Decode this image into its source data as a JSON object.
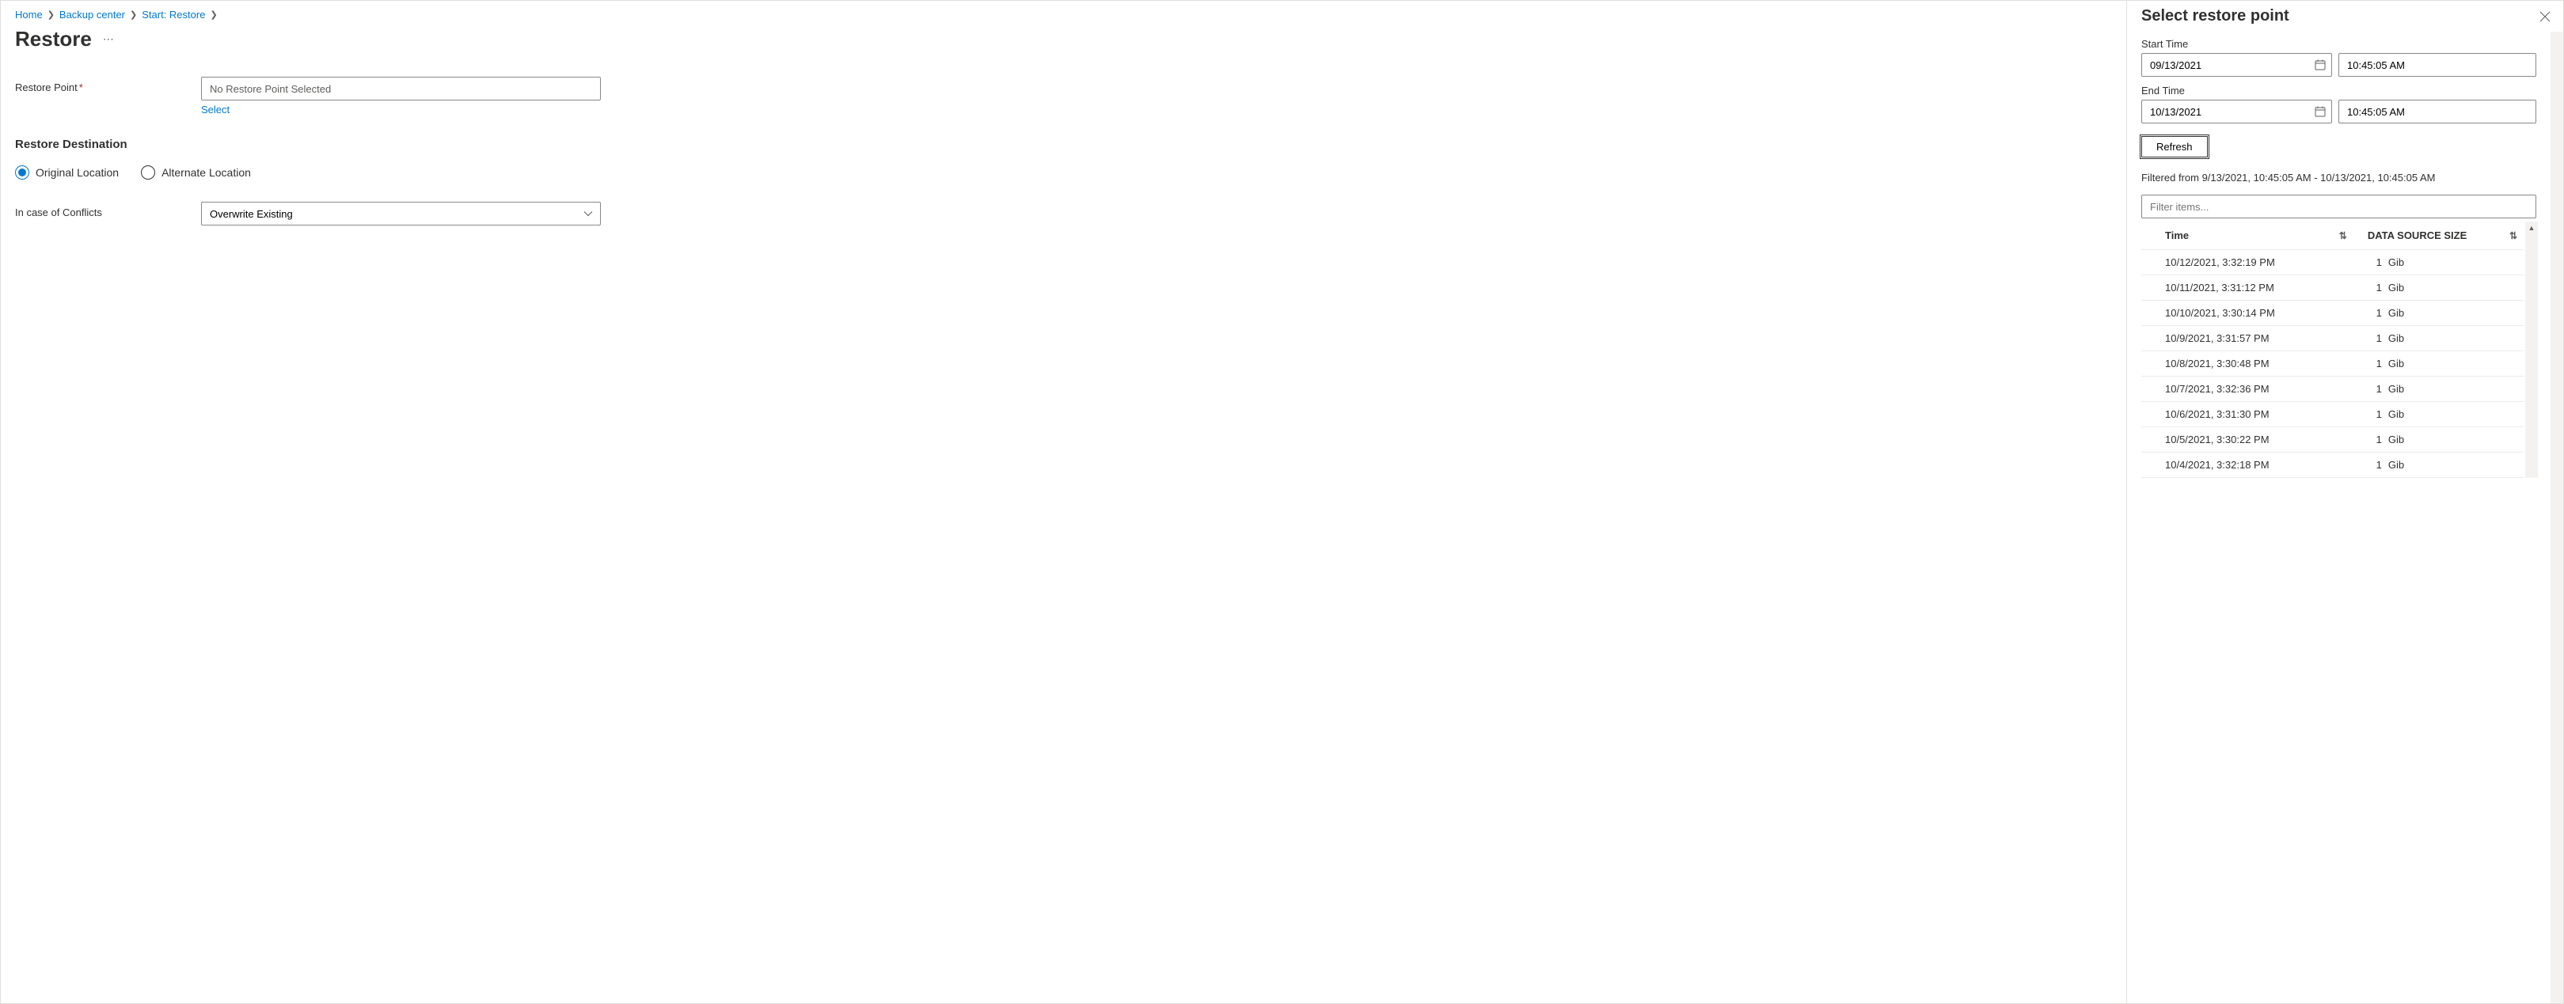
{
  "breadcrumb": [
    {
      "label": "Home"
    },
    {
      "label": "Backup center"
    },
    {
      "label": "Start: Restore"
    }
  ],
  "page": {
    "title": "Restore"
  },
  "form": {
    "restore_point_label": "Restore Point",
    "restore_point_placeholder": "No Restore Point Selected",
    "select_link": "Select",
    "destination_heading": "Restore Destination",
    "radio_original": "Original Location",
    "radio_alternate": "Alternate Location",
    "conflicts_label": "In case of Conflicts",
    "conflicts_value": "Overwrite Existing"
  },
  "panel": {
    "title": "Select restore point",
    "start_time_label": "Start Time",
    "end_time_label": "End Time",
    "start_date": "09/13/2021",
    "start_time": "10:45:05 AM",
    "end_date": "10/13/2021",
    "end_time": "10:45:05 AM",
    "refresh_label": "Refresh",
    "filtered_text": "Filtered from 9/13/2021, 10:45:05 AM - 10/13/2021, 10:45:05 AM",
    "filter_placeholder": "Filter items...",
    "columns": {
      "time": "Time",
      "size": "DATA SOURCE SIZE"
    },
    "rows": [
      {
        "time": "10/12/2021, 3:32:19 PM",
        "size_num": "1",
        "size_unit": "Gib"
      },
      {
        "time": "10/11/2021, 3:31:12 PM",
        "size_num": "1",
        "size_unit": "Gib"
      },
      {
        "time": "10/10/2021, 3:30:14 PM",
        "size_num": "1",
        "size_unit": "Gib"
      },
      {
        "time": "10/9/2021, 3:31:57 PM",
        "size_num": "1",
        "size_unit": "Gib"
      },
      {
        "time": "10/8/2021, 3:30:48 PM",
        "size_num": "1",
        "size_unit": "Gib"
      },
      {
        "time": "10/7/2021, 3:32:36 PM",
        "size_num": "1",
        "size_unit": "Gib"
      },
      {
        "time": "10/6/2021, 3:31:30 PM",
        "size_num": "1",
        "size_unit": "Gib"
      },
      {
        "time": "10/5/2021, 3:30:22 PM",
        "size_num": "1",
        "size_unit": "Gib"
      },
      {
        "time": "10/4/2021, 3:32:18 PM",
        "size_num": "1",
        "size_unit": "Gib"
      }
    ]
  }
}
